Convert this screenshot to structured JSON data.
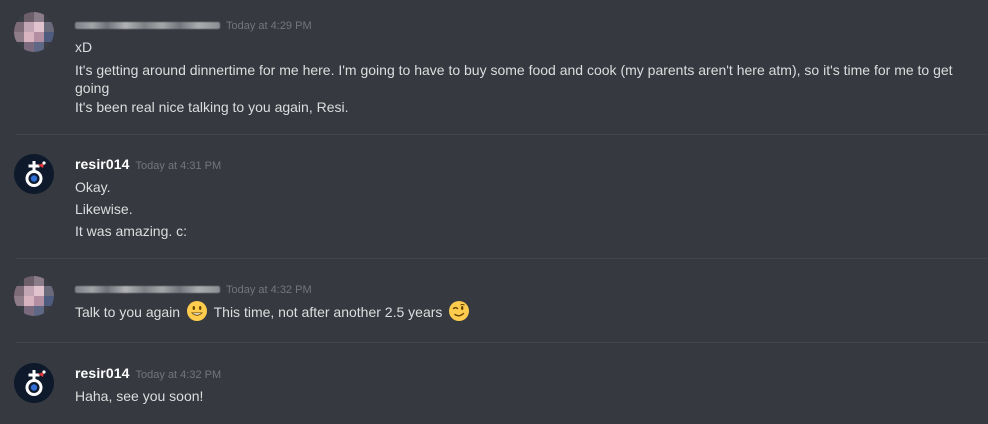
{
  "messages": [
    {
      "author": "",
      "author_obscured": true,
      "timestamp": "Today at 4:29 PM",
      "lines": [
        "xD",
        "It's getting around dinnertime for me here. I'm going to have to buy some food and cook (my parents aren't here atm), so it's time for me to get going",
        "It's been real nice talking to you again, Resi."
      ]
    },
    {
      "author": "resir014",
      "author_obscured": false,
      "timestamp": "Today at 4:31 PM",
      "lines": [
        "Okay.",
        "Likewise.",
        "It was amazing. c:"
      ]
    },
    {
      "author": "",
      "author_obscured": true,
      "timestamp": "Today at 4:32 PM",
      "line_parts": {
        "a": "Talk to you again",
        "emoji_1": "smiley-emoji",
        "b": "This time, not after another 2.5 years",
        "emoji_2": "wink-emoji"
      }
    },
    {
      "author": "resir014",
      "author_obscured": false,
      "timestamp": "Today at 4:32 PM",
      "lines": [
        "Haha, see you soon!"
      ]
    }
  ],
  "colors": {
    "background": "#36393f",
    "text": "#dcddde",
    "username": "#ffffff",
    "timestamp": "#72767d",
    "divider": "#40444b"
  }
}
